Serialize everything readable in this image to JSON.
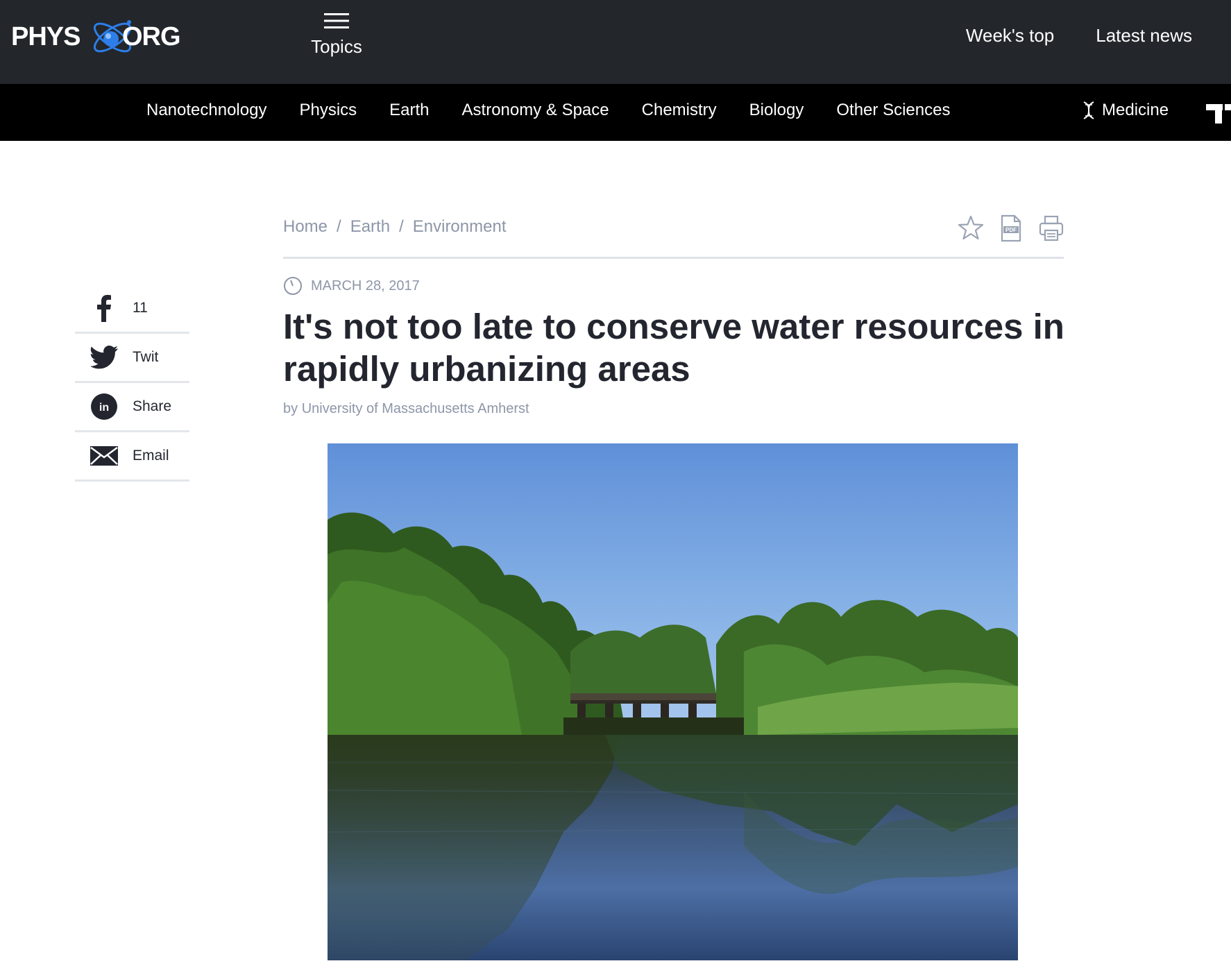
{
  "header": {
    "logo": {
      "left": "PHYS",
      "right": "ORG"
    },
    "topics_label": "Topics",
    "links": [
      "Week's top",
      "Latest news"
    ]
  },
  "categories": {
    "items": [
      "Nanotechnology",
      "Physics",
      "Earth",
      "Astronomy & Space",
      "Chemistry",
      "Biology",
      "Other Sciences"
    ],
    "medicine": "Medicine"
  },
  "breadcrumb": [
    "Home",
    "Earth",
    "Environment"
  ],
  "breadcrumb_separator": "/",
  "tools": {
    "pdf_badge": "PDF"
  },
  "article": {
    "date": "MARCH 28, 2017",
    "title": "It's not too late to conserve water resources in rapidly urbanizing areas",
    "byline_prefix": "by",
    "author": "University of Massachusetts Amherst"
  },
  "share": {
    "facebook_count": "11",
    "twitter_label": "Twit",
    "linkedin_label": "Share",
    "linkedin_badge": "in",
    "email_label": "Email"
  },
  "colors": {
    "header_bg": "#23262b",
    "nav_bg": "#000000",
    "accent_blue": "#2d7ee8",
    "muted_text": "#8d96a8",
    "title_text": "#23262f"
  }
}
